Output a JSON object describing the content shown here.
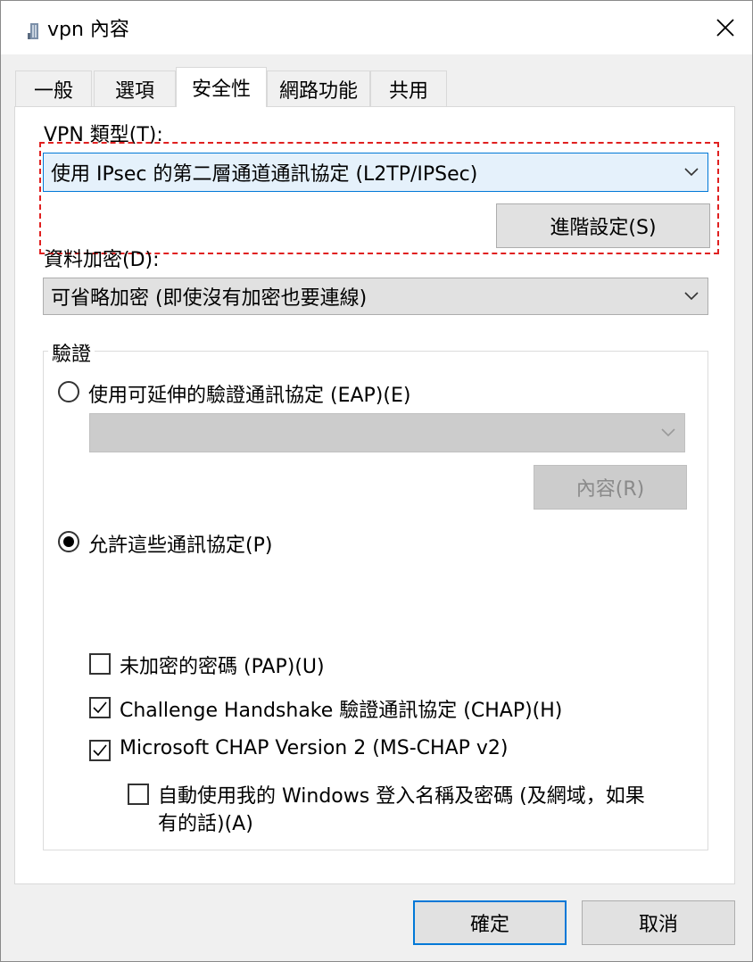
{
  "window": {
    "title": "vpn 內容"
  },
  "tabs": [
    {
      "label": "一般"
    },
    {
      "label": "選項"
    },
    {
      "label": "安全性",
      "active": true
    },
    {
      "label": "網路功能"
    },
    {
      "label": "共用"
    }
  ],
  "security": {
    "vpn_type_label": "VPN 類型(T):",
    "vpn_type_value": "使用 IPsec 的第二層通道通訊協定 (L2TP/IPSec)",
    "advanced_button": "進階設定(S)",
    "encryption_label": "資料加密(D):",
    "encryption_value": "可省略加密 (即使沒有加密也要連線)",
    "auth_group_title": "驗證",
    "eap_radio_label": "使用可延伸的驗證通訊協定 (EAP)(E)",
    "eap_radio_selected": false,
    "eap_select_value": "",
    "eap_properties_button": "內容(R)",
    "allow_radio_label": "允許這些通訊協定(P)",
    "allow_radio_selected": true,
    "protocols": [
      {
        "label": "未加密的密碼 (PAP)(U)",
        "checked": false
      },
      {
        "label": "Challenge Handshake 驗證通訊協定 (CHAP)(H)",
        "checked": true
      },
      {
        "label": "Microsoft CHAP Version 2 (MS-CHAP v2)",
        "checked": true
      }
    ],
    "auto_windows_label_line1": "自動使用我的 Windows 登入名稱及密碼 (及網域，如果",
    "auto_windows_label_line2": "有的話)(A)",
    "auto_windows_checked": false
  },
  "footer": {
    "ok_button": "確定",
    "cancel_button": "取消"
  },
  "colors": {
    "highlight_border": "#e02020",
    "selected_combo_bg": "#e5f1fb",
    "selected_combo_border": "#0078d7",
    "default_button_border": "#0078d7"
  }
}
